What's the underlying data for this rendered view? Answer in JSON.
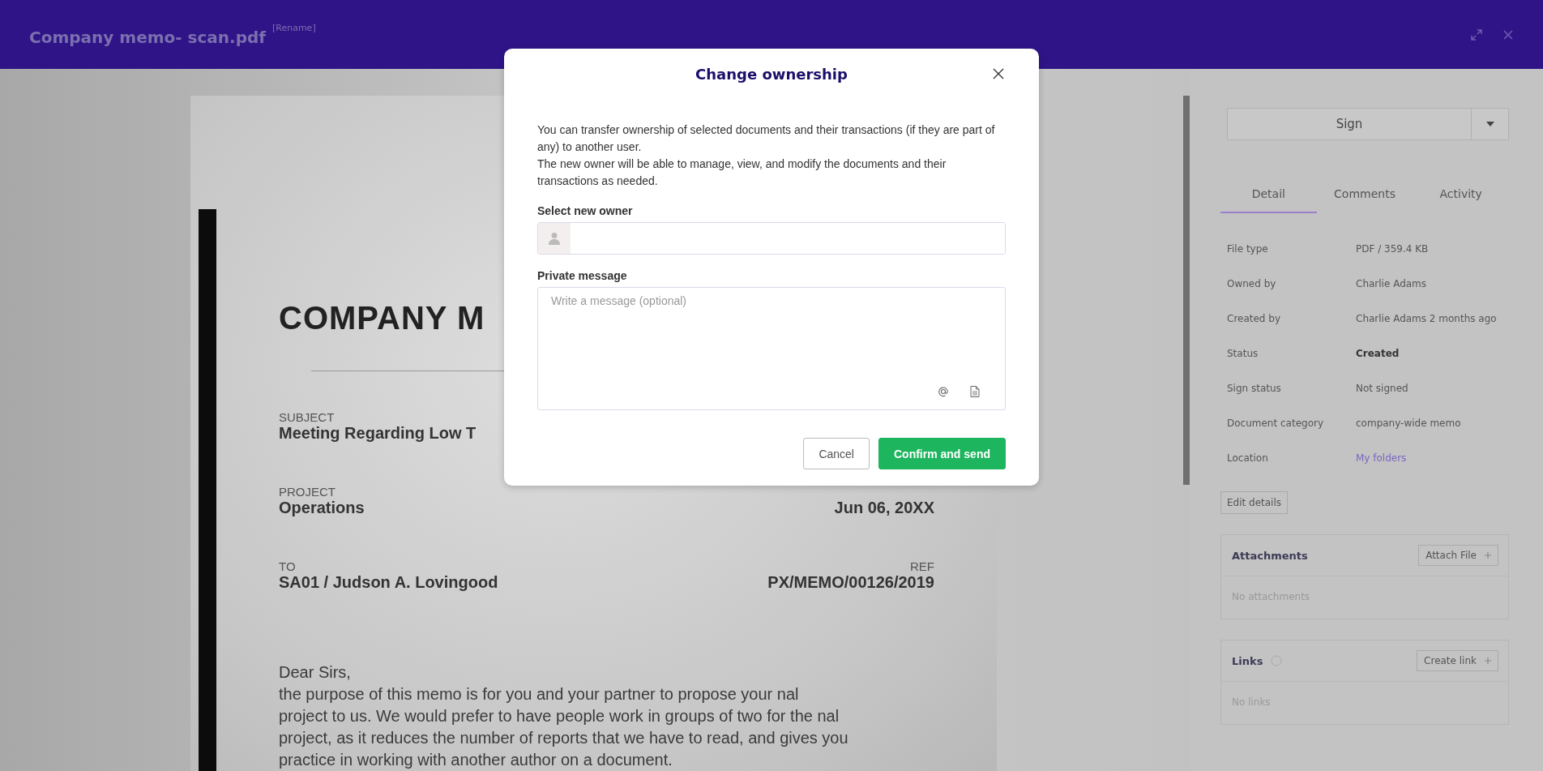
{
  "header": {
    "title": "Company memo- scan.pdf",
    "rename": "[Rename]"
  },
  "document": {
    "title": "COMPANY M",
    "rows": [
      {
        "left": {
          "label": "SUBJECT",
          "value": "Meeting Regarding Low T"
        }
      },
      {
        "left": {
          "label": "PROJECT",
          "value": "Operations"
        },
        "right": {
          "value": "Jun 06, 20XX"
        }
      },
      {
        "left": {
          "label": "TO",
          "value": "SA01 / Judson A. Lovingood"
        },
        "right": {
          "label": "REF",
          "value": "PX/MEMO/00126/2019"
        }
      }
    ],
    "body": [
      "Dear Sirs,",
      "the purpose of this memo is for you and your partner to propose your nal",
      "project to us. We would prefer to have people work in groups of two for the nal",
      "project, as it reduces the number of reports that we have to read, and gives you",
      "practice in working with another author on a document."
    ]
  },
  "sidebar": {
    "sign_button": "Sign",
    "tabs": [
      {
        "label": "Detail",
        "selected": true
      },
      {
        "label": "Comments",
        "selected": false
      },
      {
        "label": "Activity",
        "selected": false
      }
    ],
    "details": [
      {
        "label": "File type",
        "value": "PDF / 359.4 KB",
        "kind": "text"
      },
      {
        "label": "Owned by",
        "value": "Charlie Adams",
        "kind": "text"
      },
      {
        "label": "Created by",
        "value": "Charlie Adams 2 months ago",
        "kind": "text"
      },
      {
        "label": "Status",
        "value": "Created",
        "kind": "bold"
      },
      {
        "label": "Sign status",
        "value": "Not signed",
        "kind": "text"
      },
      {
        "label": "Document category",
        "value": "company-wide memo",
        "kind": "text"
      },
      {
        "label": "Location",
        "value": "My folders",
        "kind": "link"
      }
    ],
    "edit_button": "Edit details",
    "panels": [
      {
        "title": "Attachments",
        "info": false,
        "action": "Attach File",
        "empty": "No attachments"
      },
      {
        "title": "Links",
        "info": true,
        "action": "Create link",
        "empty": "No links"
      }
    ]
  },
  "dialog": {
    "title": "Change ownership",
    "paragraphs": [
      "You can transfer ownership of selected documents and their transactions (if they are part of any) to another user.",
      "The new owner will be able to manage, view, and modify the documents and their transactions as needed."
    ],
    "owner_label": "Select new owner",
    "message_label": "Private message",
    "message_placeholder": "Write a message (optional)",
    "buttons": [
      {
        "label": "Cancel",
        "kind": "secondary"
      },
      {
        "label": "Confirm and send",
        "kind": "primary"
      }
    ]
  }
}
